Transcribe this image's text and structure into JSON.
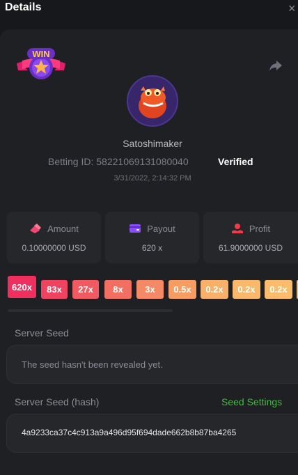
{
  "header": {
    "title": "Details",
    "close_symbol": "×"
  },
  "badge": {
    "text": "WIN"
  },
  "player": {
    "username": "Satoshimaker",
    "betting_id_label": "Betting ID:",
    "betting_id": "58221069131080040",
    "verified_label": "Verified",
    "date": "3/31/2022, 2:14:32 PM"
  },
  "stats": {
    "amount": {
      "label": "Amount",
      "value": "0.10000000 USD",
      "icon": "amount-icon",
      "color": "#f0466f"
    },
    "payout": {
      "label": "Payout",
      "value": "620 x",
      "icon": "wallet-icon",
      "color": "#8a4dff"
    },
    "profit": {
      "label": "Profit",
      "value": "61.9000000 USD",
      "icon": "profit-icon",
      "color": "#f03c4a"
    }
  },
  "multipliers": {
    "top": {
      "label": "620x",
      "color": "#ef2f5d"
    },
    "items": [
      {
        "label": "83x",
        "color": "#ef4360"
      },
      {
        "label": "27x",
        "color": "#f25a61"
      },
      {
        "label": "8x",
        "color": "#f36f62"
      },
      {
        "label": "3x",
        "color": "#f58865"
      },
      {
        "label": "0.5x",
        "color": "#f79c63"
      },
      {
        "label": "0.2x",
        "color": "#f9b068"
      },
      {
        "label": "0.2x",
        "color": "#fab86a"
      },
      {
        "label": "0.2x",
        "color": "#fbbd6b"
      },
      {
        "label": "",
        "color": "#fbbd6b"
      }
    ]
  },
  "server_seed": {
    "label": "Server Seed",
    "value": "The seed hasn't been revealed yet."
  },
  "server_seed_hash": {
    "label": "Server Seed (hash)",
    "settings_label": "Seed Settings",
    "value": "4a9233ca37c4c913a9a496d95f694dade662b8b87ba4265"
  },
  "colors": {
    "background": "#17181b",
    "panel": "#1f2023",
    "card": "#26272b",
    "accent_green": "#3bbf37"
  }
}
